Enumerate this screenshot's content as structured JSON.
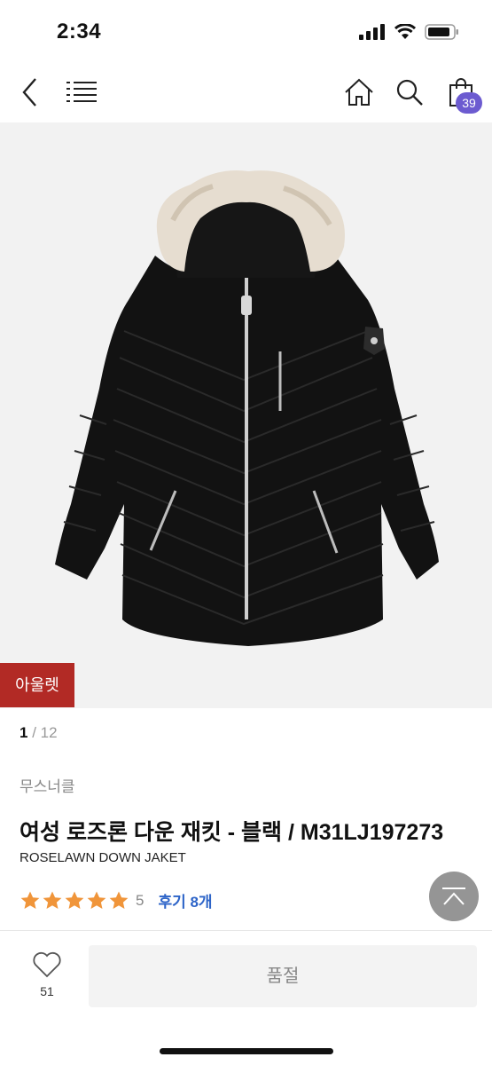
{
  "status": {
    "time": "2:34"
  },
  "nav": {
    "cart_count": "39"
  },
  "product": {
    "image_badge": "아울렛",
    "pager_current": "1",
    "pager_total": "/ 12",
    "brand": "무스너클",
    "title": "여성 로즈론 다운 재킷 - 블랙 / M31LJ197273",
    "subtitle": "ROSELAWN DOWN JAKET",
    "rating": "5",
    "reviews": "후기 8개"
  },
  "bottom": {
    "like_count": "51",
    "buy_label": "품절"
  },
  "colors": {
    "accent_badge": "#6c5bd0",
    "outlet_tag": "#b22a25",
    "star": "#f0953a",
    "review_link": "#2d64c8"
  },
  "icons": [
    "back-icon",
    "menu-icon",
    "home-icon",
    "search-icon",
    "shopping-bag-icon",
    "heart-icon",
    "scroll-top-icon",
    "star-icon",
    "signal-icon",
    "wifi-icon",
    "battery-icon"
  ]
}
